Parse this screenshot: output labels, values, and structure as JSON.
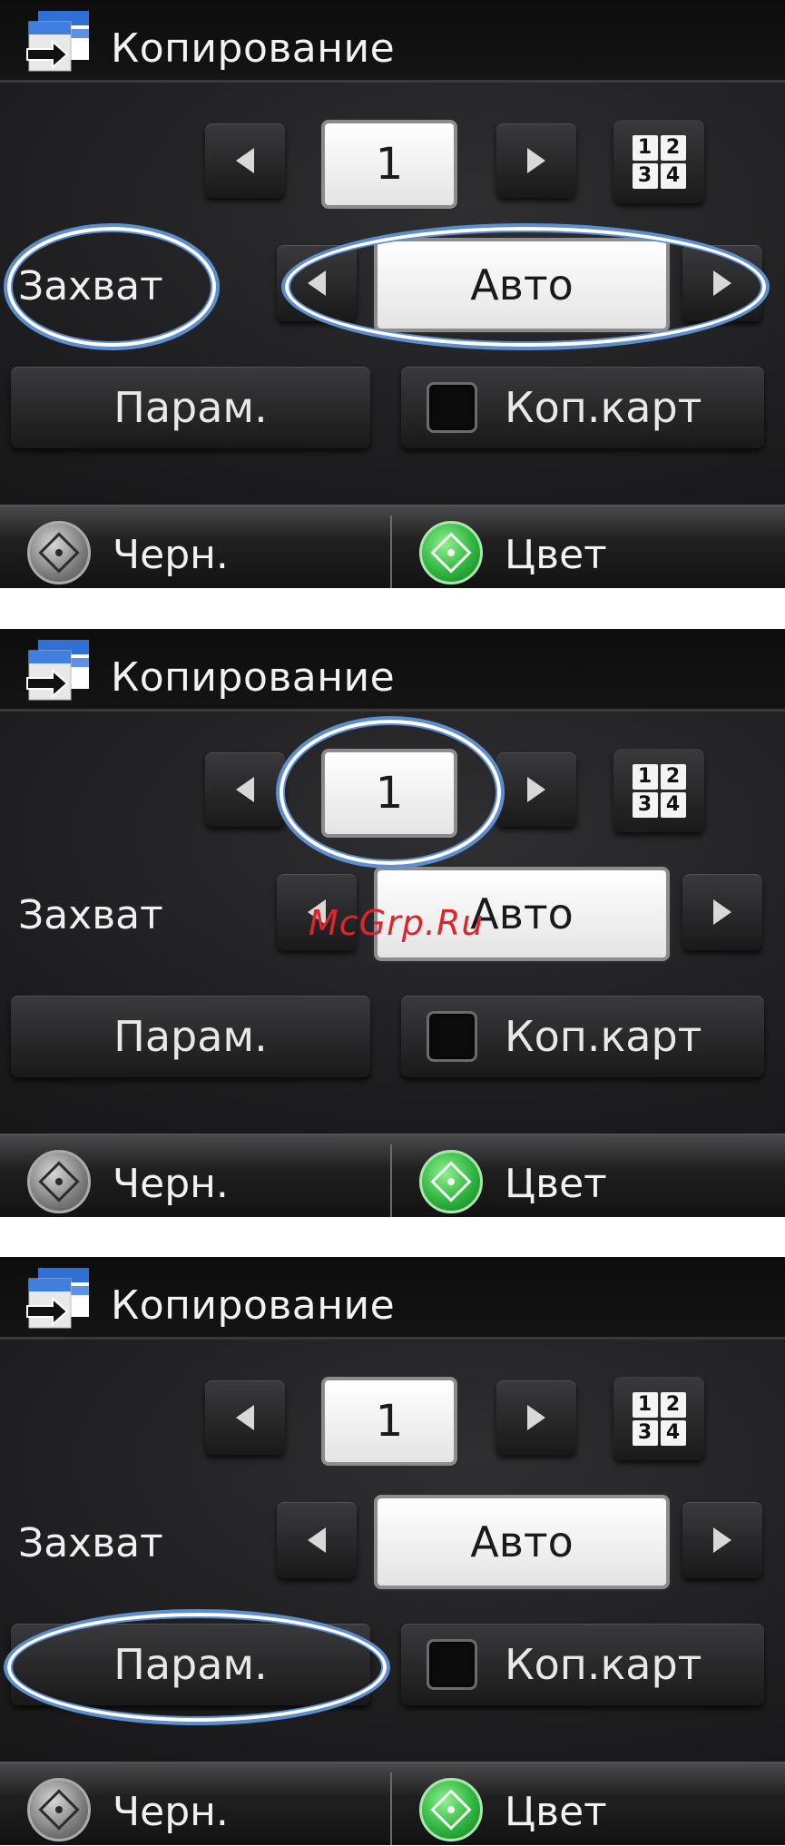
{
  "screen": {
    "title": "Копирование",
    "copies_value": "1",
    "layout_digits": [
      "1",
      "2",
      "3",
      "4"
    ],
    "capture_label": "Захват",
    "capture_value": "Авто",
    "params_label": "Парам.",
    "collate_label": "Коп.карт",
    "mono_start_label": "Черн.",
    "color_start_label": "Цвет"
  },
  "watermark": "McGrp.Ru",
  "colors": {
    "highlight_ring": "#5b8fd0",
    "color_start": "#2fb540",
    "watermark": "#e0242b"
  },
  "panels": [
    {
      "highlighted": [
        "capture-label",
        "capture-field"
      ]
    },
    {
      "highlighted": [
        "copies-counter"
      ]
    },
    {
      "highlighted": [
        "params-button"
      ]
    }
  ]
}
